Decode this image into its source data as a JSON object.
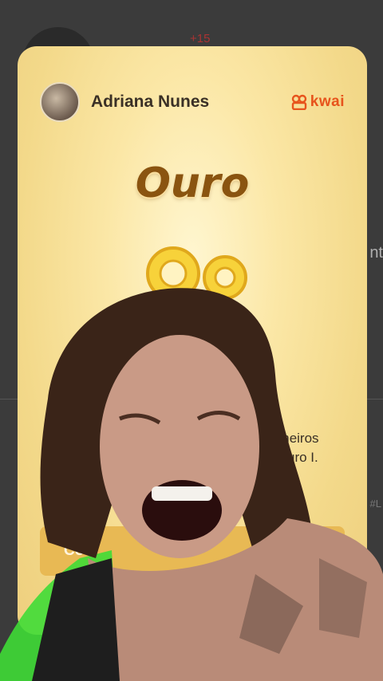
{
  "background": {
    "plus_badge": "+15",
    "side_text": "nt",
    "side_tag": "#L"
  },
  "card": {
    "user_name": "Adriana Nunes",
    "brand": "kwai",
    "level_title": "Ouro",
    "description_line1": "P                                                  primeiros",
    "description_line2": "10                                                el Ouro I.",
    "cta_label": "Co"
  },
  "colors": {
    "accent": "#e7541c",
    "title": "#8a5410",
    "button": "#e8b954"
  },
  "icons": {
    "brand": "kwai-logo-icon",
    "coin": "coin-icon"
  }
}
